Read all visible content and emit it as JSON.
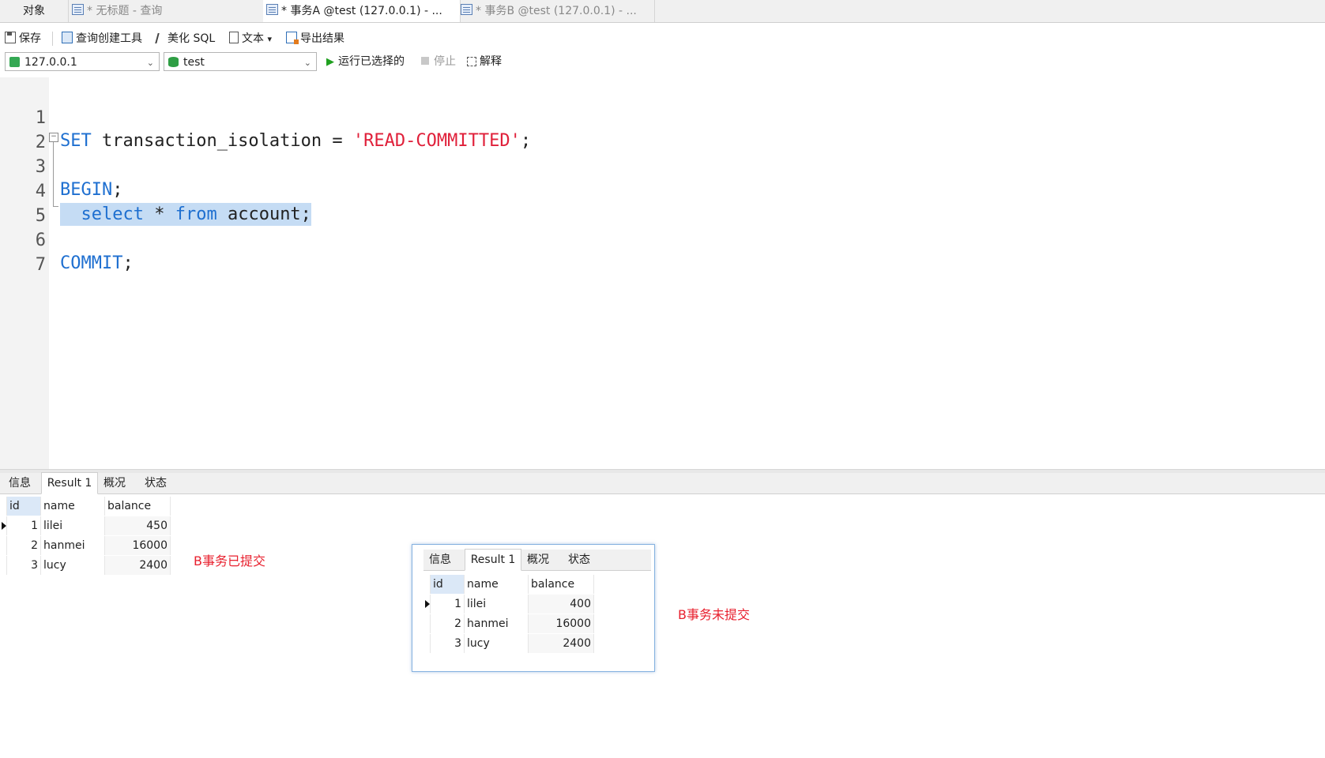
{
  "tabs": {
    "objects": "对象",
    "tab1": "* 无标题 - 查询",
    "tab2": "* 事务A @test (127.0.0.1) - ...",
    "tab3": "* 事务B @test (127.0.0.1) - ..."
  },
  "toolbar": {
    "save": "保存",
    "query_builder": "查询创建工具",
    "beautify": "美化 SQL",
    "text": "文本",
    "text_arrow": "▾",
    "export": "导出结果"
  },
  "connection": {
    "value": "127.0.0.1"
  },
  "database": {
    "value": "test"
  },
  "run": {
    "run_selected": "运行已选择的",
    "stop": "停止",
    "explain": "解释"
  },
  "editor": {
    "line_numbers": [
      "1",
      "2",
      "3",
      "4",
      "5",
      "6",
      "7"
    ],
    "line1": {
      "kw": "SET",
      "mid": " transaction_isolation = ",
      "str": "'READ-COMMITTED'",
      "end": ";"
    },
    "line3": {
      "kw": "BEGIN",
      "end": ";"
    },
    "line4": {
      "indent": "  ",
      "kw1": "select",
      "mid1": " * ",
      "kw2": "from",
      "end": " account;"
    },
    "line6": {
      "kw": "COMMIT",
      "end": ";"
    }
  },
  "result_tabs": [
    "信息",
    "Result 1",
    "概况",
    "状态"
  ],
  "grid_main": {
    "columns": [
      "id",
      "name",
      "balance"
    ],
    "rows": [
      [
        "1",
        "lilei",
        "450"
      ],
      [
        "2",
        "hanmei",
        "16000"
      ],
      [
        "3",
        "lucy",
        "2400"
      ]
    ]
  },
  "grid_popup": {
    "columns": [
      "id",
      "name",
      "balance"
    ],
    "rows": [
      [
        "1",
        "lilei",
        "400"
      ],
      [
        "2",
        "hanmei",
        "16000"
      ],
      [
        "3",
        "lucy",
        "2400"
      ]
    ]
  },
  "annotations": {
    "committed": "B事务已提交",
    "uncommitted": "B事务未提交"
  },
  "colors": {
    "keyword": "#1e6fd0",
    "string": "#e0203a",
    "selection": "#c5dcf4",
    "annotation": "#e8202e"
  }
}
